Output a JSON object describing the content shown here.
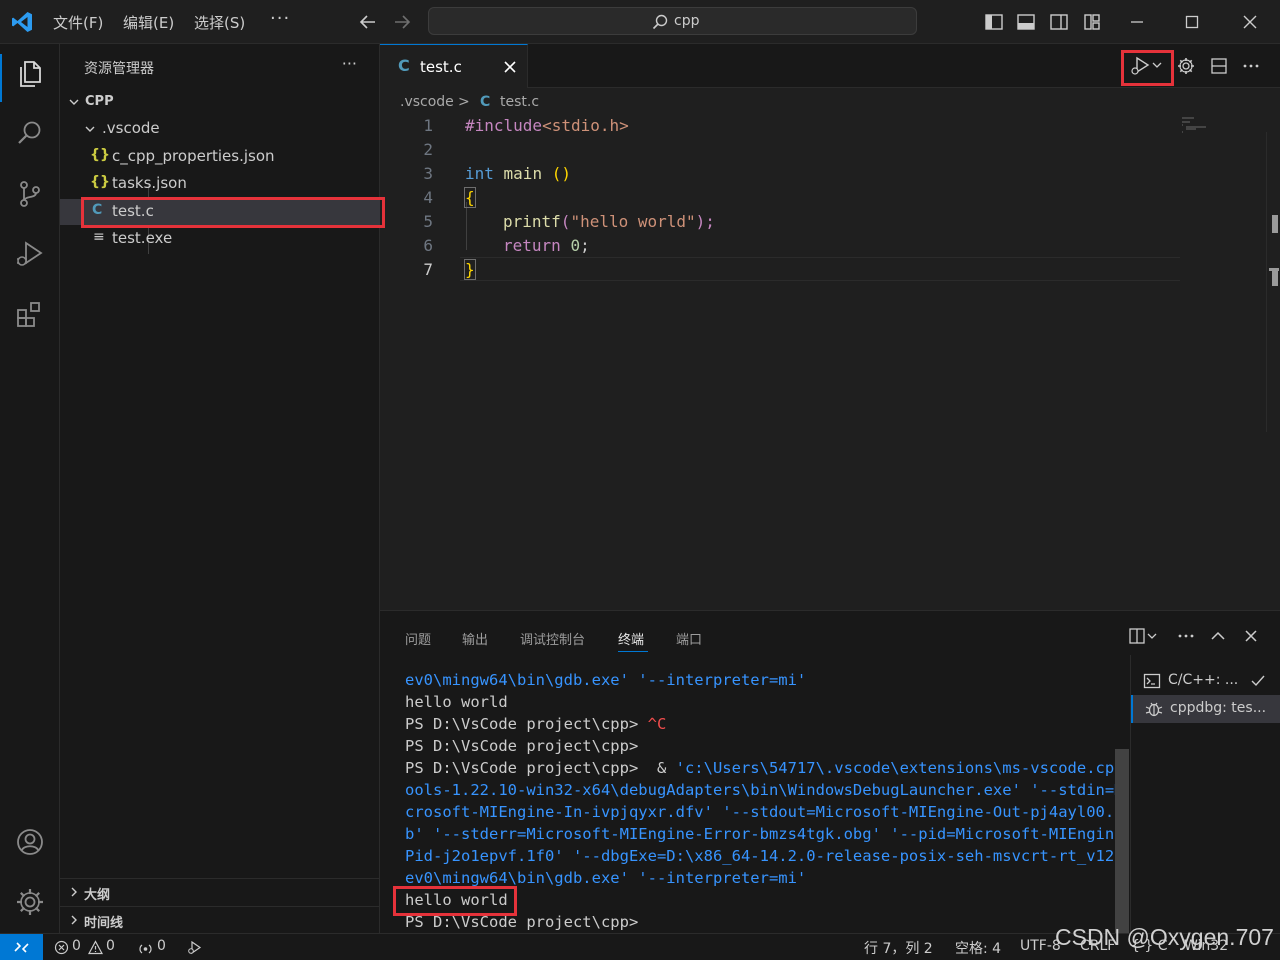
{
  "titlebar": {
    "menu": [
      "文件(F)",
      "编辑(E)",
      "选择(S)"
    ],
    "more": "···",
    "command_center": "cpp"
  },
  "sidebar": {
    "title": "资源管理器",
    "more": "···",
    "tree": {
      "root": "CPP",
      "folder": ".vscode",
      "files": [
        {
          "icon": "{}",
          "label": "c_cpp_properties.json"
        },
        {
          "icon": "{}",
          "label": "tasks.json"
        },
        {
          "icon": "C",
          "label": "test.c"
        },
        {
          "icon": "≡",
          "label": "test.exe"
        }
      ]
    },
    "sections": [
      "大纲",
      "时间线"
    ]
  },
  "editor": {
    "tab": {
      "icon": "C",
      "label": "test.c"
    },
    "breadcrumb": {
      "folder": ".vscode",
      "sep": ">",
      "icon": "C",
      "file": "test.c"
    },
    "line_numbers": [
      "1",
      "2",
      "3",
      "4",
      "5",
      "6",
      "7"
    ],
    "code": {
      "l1_directive": "#include",
      "l1_header": "<stdio.h>",
      "l3_type": "int",
      "l3_name": " main ",
      "l3_parens": "()",
      "l4": "{",
      "l5_fn": "printf",
      "l5_open": "(",
      "l5_str": "\"hello world\"",
      "l5_close": ");",
      "l6_kw": "return",
      "l6_num": "0",
      "l6_end": ";",
      "l7": "}"
    }
  },
  "panel": {
    "tabs": [
      "问题",
      "输出",
      "调试控制台",
      "终端",
      "端口"
    ],
    "active_tab": "终端",
    "terminal_lines": [
      {
        "cls": "blue",
        "text": "ev0\\mingw64\\bin\\gdb.exe' '--interpreter=mi'"
      },
      {
        "cls": "",
        "text": "hello world"
      },
      {
        "cls": "",
        "text": "PS D:\\VsCode project\\cpp> ",
        "extra": "^C",
        "extra_cls": "red"
      },
      {
        "cls": "",
        "text": "PS D:\\VsCode project\\cpp>"
      },
      {
        "cls": "",
        "text": "PS D:\\VsCode project\\cpp>  & ",
        "extra": "'c:\\Users\\54717\\.vscode\\extensions\\ms-vscode.cppt",
        "extra_cls": "blue"
      },
      {
        "cls": "blue",
        "text": "ools-1.22.10-win32-x64\\debugAdapters\\bin\\WindowsDebugLauncher.exe' '--stdin=Mi"
      },
      {
        "cls": "blue",
        "text": "crosoft-MIEngine-In-ivpjqyxr.dfv' '--stdout=Microsoft-MIEngine-Out-pj4ayl00.ut"
      },
      {
        "cls": "blue",
        "text": "b' '--stderr=Microsoft-MIEngine-Error-bmzs4tgk.obg' '--pid=Microsoft-MIEngine-"
      },
      {
        "cls": "blue",
        "text": "Pid-j2o1epvf.1f0' '--dbgExe=D:\\x86_64-14.2.0-release-posix-seh-msvcrt-rt_v12-r"
      },
      {
        "cls": "blue",
        "text": "ev0\\mingw64\\bin\\gdb.exe' '--interpreter=mi'"
      },
      {
        "cls": "",
        "text": "hello world"
      },
      {
        "cls": "",
        "text": "PS D:\\VsCode project\\cpp>"
      }
    ],
    "terminals": [
      {
        "label": "C/C++: ...",
        "icon": "terminal-icon"
      },
      {
        "label": "cppdbg: tes...",
        "icon": "debug-icon"
      }
    ]
  },
  "statusbar": {
    "errors": "0",
    "warnings": "0",
    "ports": "0",
    "position": "行 7，列 2",
    "spaces": "空格: 4",
    "encoding": "UTF-8",
    "eol": "CRLF",
    "lang": "{ } C",
    "platform": "Win32"
  },
  "watermark": "CSDN @Oxygen.707",
  "colors": {
    "accent": "#0078d4",
    "highlight_box": "#e5323a",
    "keyword": "#569cd6",
    "string": "#ce9178",
    "function": "#dcdcaa"
  }
}
